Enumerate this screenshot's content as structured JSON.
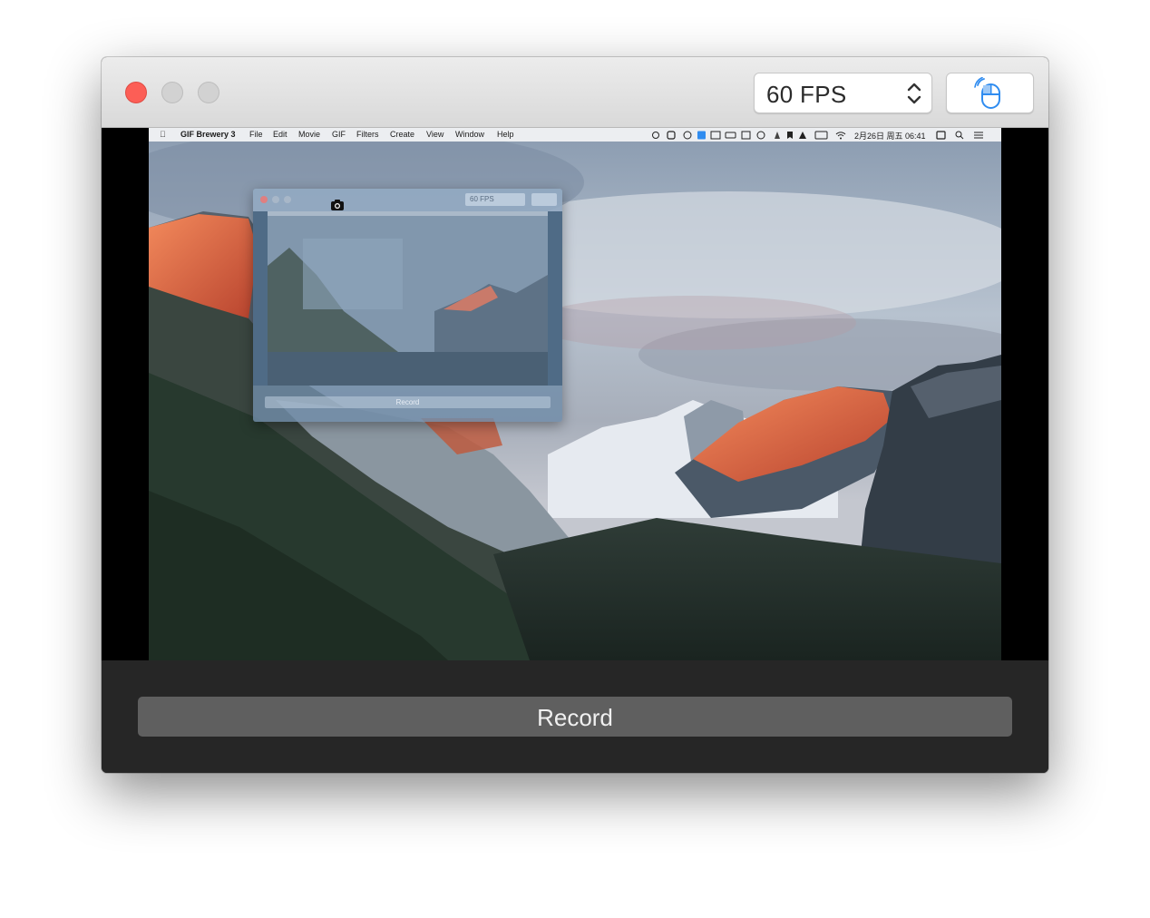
{
  "toolbar": {
    "fps_value": "60 FPS",
    "fps_icon": "up-down-chevron-icon",
    "mouse_icon": "mouse-click-icon"
  },
  "menubar": {
    "apple_icon": "apple-icon",
    "app_name": "GIF Brewery 3",
    "items": [
      "File",
      "Edit",
      "Movie",
      "GIF",
      "Filters",
      "Create",
      "View",
      "Window",
      "Help"
    ],
    "datetime": "2月26日 周五 06:41"
  },
  "inner_window": {
    "fps_value": "60 FPS",
    "record_label": "Record"
  },
  "record": {
    "label": "Record"
  },
  "colors": {
    "close": "#fc5e56",
    "accent": "#2f8cf0",
    "record_button": "#5f5f5f",
    "bottom_bar": "#262626"
  }
}
